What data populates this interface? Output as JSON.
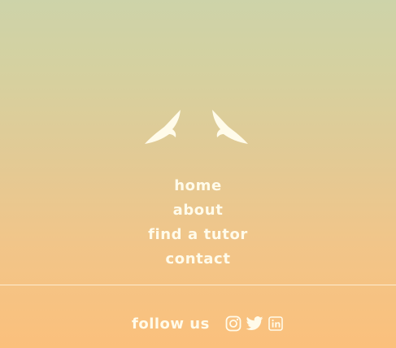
{
  "colors": {
    "foreground": "#fffbea",
    "gradient_top": "#cdd3a9",
    "gradient_bottom": "#fbc07c"
  },
  "logo": {
    "icon": "two-birds-icon"
  },
  "nav": {
    "items": [
      {
        "label": "home"
      },
      {
        "label": "about"
      },
      {
        "label": "find a tutor"
      },
      {
        "label": "contact"
      }
    ]
  },
  "footer": {
    "follow_label": "follow us",
    "social": [
      {
        "icon": "instagram-icon"
      },
      {
        "icon": "twitter-icon"
      },
      {
        "icon": "linkedin-icon"
      }
    ]
  }
}
